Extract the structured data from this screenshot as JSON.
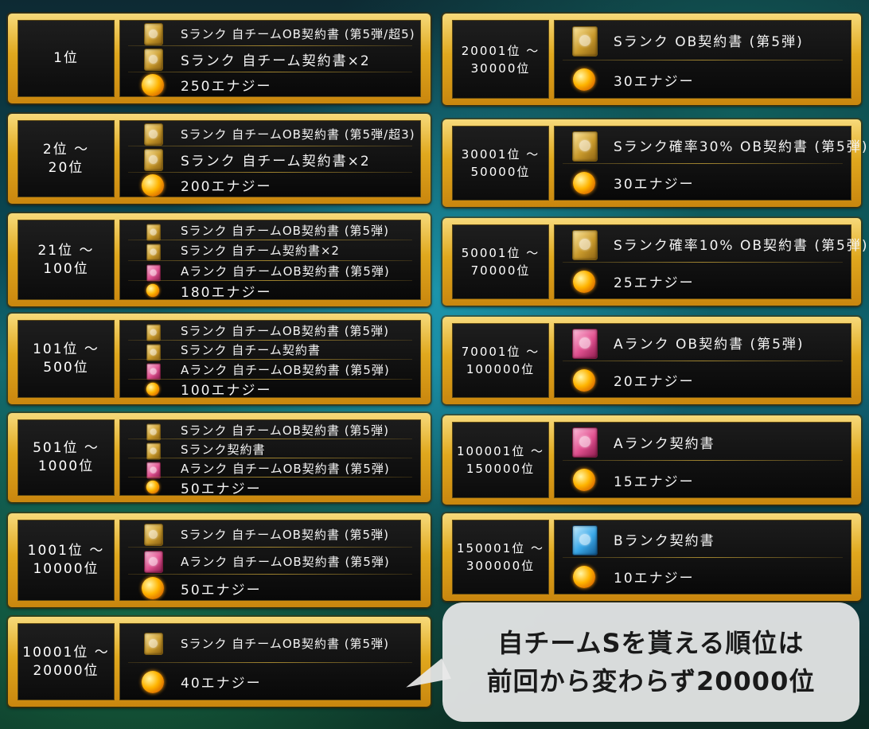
{
  "left_panels": [
    {
      "rank": "1位",
      "rewards": [
        {
          "icon": "s-rank-card-icon",
          "color": "gold",
          "text": "Sランク 自チームOB契約書 (第5弾/超5)"
        },
        {
          "icon": "s-rank-card-icon",
          "color": "gold",
          "text": "Sランク 自チーム契約書×2"
        },
        {
          "icon": "energy-icon",
          "color": "energy",
          "text": "250エナジー"
        }
      ]
    },
    {
      "rank": "2位 ～\n20位",
      "rewards": [
        {
          "icon": "s-rank-card-icon",
          "color": "gold",
          "text": "Sランク 自チームOB契約書 (第5弾/超3)"
        },
        {
          "icon": "s-rank-card-icon",
          "color": "gold",
          "text": "Sランク 自チーム契約書×2"
        },
        {
          "icon": "energy-icon",
          "color": "energy",
          "text": "200エナジー"
        }
      ]
    },
    {
      "rank": "21位 ～\n100位",
      "rewards": [
        {
          "icon": "s-rank-card-icon",
          "color": "gold",
          "text": "Sランク 自チームOB契約書 (第5弾)"
        },
        {
          "icon": "s-rank-card-icon",
          "color": "gold",
          "text": "Sランク 自チーム契約書×2"
        },
        {
          "icon": "a-rank-card-icon",
          "color": "pink",
          "text": "Aランク 自チームOB契約書 (第5弾)"
        },
        {
          "icon": "energy-icon",
          "color": "energy",
          "text": "180エナジー"
        }
      ]
    },
    {
      "rank": "101位 ～\n500位",
      "rewards": [
        {
          "icon": "s-rank-card-icon",
          "color": "gold",
          "text": "Sランク 自チームOB契約書 (第5弾)"
        },
        {
          "icon": "s-rank-card-icon",
          "color": "gold",
          "text": "Sランク 自チーム契約書"
        },
        {
          "icon": "a-rank-card-icon",
          "color": "pink",
          "text": "Aランク 自チームOB契約書 (第5弾)"
        },
        {
          "icon": "energy-icon",
          "color": "energy",
          "text": "100エナジー"
        }
      ]
    },
    {
      "rank": "501位 ～\n1000位",
      "rewards": [
        {
          "icon": "s-rank-card-icon",
          "color": "gold",
          "text": "Sランク 自チームOB契約書 (第5弾)"
        },
        {
          "icon": "s-rank-card-icon",
          "color": "gold",
          "text": "Sランク契約書"
        },
        {
          "icon": "a-rank-card-icon",
          "color": "pink",
          "text": "Aランク 自チームOB契約書 (第5弾)"
        },
        {
          "icon": "energy-icon",
          "color": "energy",
          "text": "50エナジー"
        }
      ]
    },
    {
      "rank": "1001位 ～\n10000位",
      "rewards": [
        {
          "icon": "s-rank-card-icon",
          "color": "gold",
          "text": "Sランク 自チームOB契約書 (第5弾)"
        },
        {
          "icon": "a-rank-card-icon",
          "color": "pink",
          "text": "Aランク 自チームOB契約書 (第5弾)"
        },
        {
          "icon": "energy-icon",
          "color": "energy",
          "text": "50エナジー"
        }
      ]
    },
    {
      "rank": "10001位 ～\n20000位",
      "rewards": [
        {
          "icon": "s-rank-card-icon",
          "color": "gold",
          "text": "Sランク 自チームOB契約書 (第5弾)"
        },
        {
          "icon": "energy-icon",
          "color": "energy",
          "text": "40エナジー"
        }
      ]
    }
  ],
  "right_panels": [
    {
      "rank": "20001位 ～\n30000位",
      "rewards": [
        {
          "icon": "s-rank-card-icon",
          "color": "gold",
          "text": "Sランク OB契約書 (第5弾)"
        },
        {
          "icon": "energy-icon",
          "color": "energy",
          "text": "30エナジー"
        }
      ]
    },
    {
      "rank": "30001位 ～\n50000位",
      "rewards": [
        {
          "icon": "s-rank-card-icon",
          "color": "gold",
          "text": "Sランク確率30% OB契約書 (第5弾)"
        },
        {
          "icon": "energy-icon",
          "color": "energy",
          "text": "30エナジー"
        }
      ]
    },
    {
      "rank": "50001位 ～\n70000位",
      "rewards": [
        {
          "icon": "s-rank-card-icon",
          "color": "gold",
          "text": "Sランク確率10% OB契約書 (第5弾)"
        },
        {
          "icon": "energy-icon",
          "color": "energy",
          "text": "25エナジー"
        }
      ]
    },
    {
      "rank": "70001位 ～\n100000位",
      "rewards": [
        {
          "icon": "a-rank-card-icon",
          "color": "pink",
          "text": "Aランク OB契約書 (第5弾)"
        },
        {
          "icon": "energy-icon",
          "color": "energy",
          "text": "20エナジー"
        }
      ]
    },
    {
      "rank": "100001位 ～\n150000位",
      "rewards": [
        {
          "icon": "a-rank-card-icon",
          "color": "pink",
          "text": "Aランク契約書"
        },
        {
          "icon": "energy-icon",
          "color": "energy",
          "text": "15エナジー"
        }
      ]
    },
    {
      "rank": "150001位 ～\n300000位",
      "rewards": [
        {
          "icon": "b-rank-card-icon",
          "color": "blue",
          "text": "Bランク契約書"
        },
        {
          "icon": "energy-icon",
          "color": "energy",
          "text": "10エナジー"
        }
      ]
    }
  ],
  "bubble": {
    "line1": "自チームSを貰える順位は",
    "line2": "前回から変わらず20000位"
  }
}
